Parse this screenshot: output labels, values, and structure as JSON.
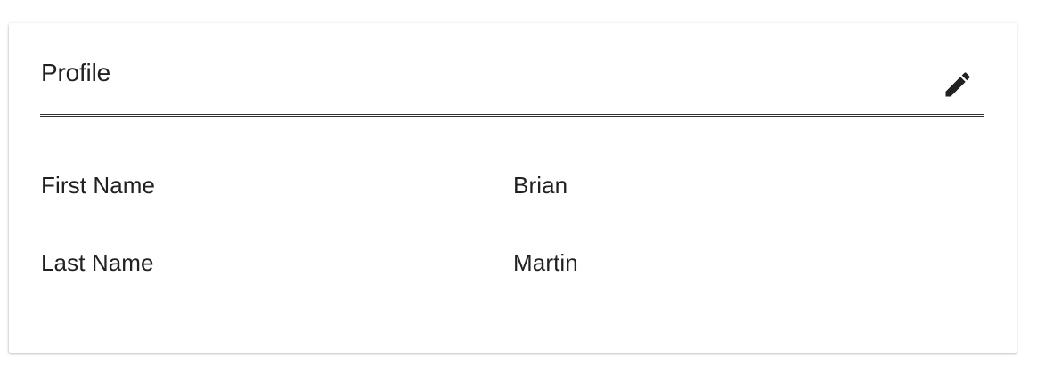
{
  "card": {
    "title": "Profile",
    "edit_icon": "pencil-icon"
  },
  "fields": [
    {
      "label": "First Name",
      "value": "Brian"
    },
    {
      "label": "Last Name",
      "value": "Martin"
    }
  ]
}
